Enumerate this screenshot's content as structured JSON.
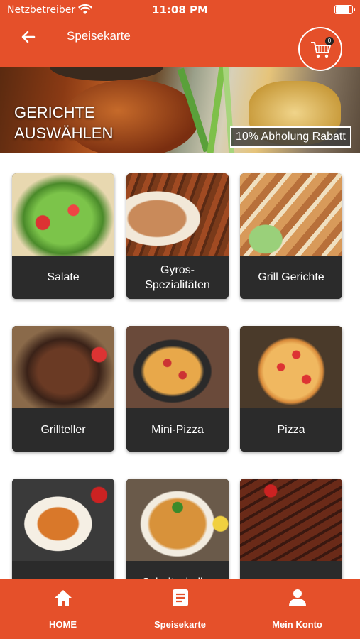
{
  "status": {
    "carrier": "Netzbetreiber",
    "time": "11:08 PM"
  },
  "header": {
    "title": "Speisekarte",
    "cart_count": "0"
  },
  "banner": {
    "heading": "GERICHTE AUSWÄHLEN",
    "promo": "10% Abholung Rabatt"
  },
  "categories": [
    {
      "label": "Salate"
    },
    {
      "label": "Gyros-Spezialitäten"
    },
    {
      "label": "Grill Gerichte"
    },
    {
      "label": "Grillteller"
    },
    {
      "label": "Mini-Pizza"
    },
    {
      "label": "Pizza"
    },
    {
      "label": ""
    },
    {
      "label": "Schnitzel aller"
    },
    {
      "label": ""
    }
  ],
  "tabbar": {
    "home": {
      "label": "HOME",
      "icon": "home-icon"
    },
    "menu": {
      "label": "Speisekarte",
      "icon": "menu-card-icon"
    },
    "account": {
      "label": "Mein Konto",
      "icon": "user-icon"
    }
  },
  "colors": {
    "accent": "#e5502a",
    "card_label_bg": "#2b2b2b"
  }
}
